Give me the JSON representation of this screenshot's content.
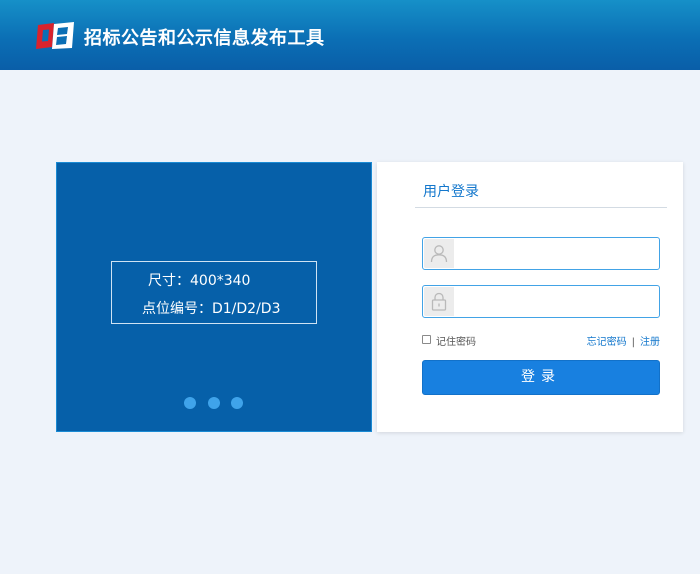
{
  "header": {
    "app_title": "招标公告和公示信息发布工具",
    "logo_icon": "cebp-logo-icon",
    "background": "#0b6fb5"
  },
  "banner": {
    "background": "#0660a9",
    "size_text": "尺寸：400*340",
    "code_text": "点位编号：D1/D2/D3",
    "slide_count": 3,
    "dot_color": "#3fa3ea"
  },
  "login": {
    "title": "用户登录",
    "username": {
      "value": "",
      "placeholder": "",
      "icon": "user-icon"
    },
    "password": {
      "value": "",
      "placeholder": "",
      "icon": "lock-icon"
    },
    "remember_label": "记住密码",
    "remember_checked": false,
    "forgot_link": "忘记密码",
    "separator": "|",
    "register_link": "注册",
    "submit_label": "登录",
    "accent": "#1880e0"
  }
}
